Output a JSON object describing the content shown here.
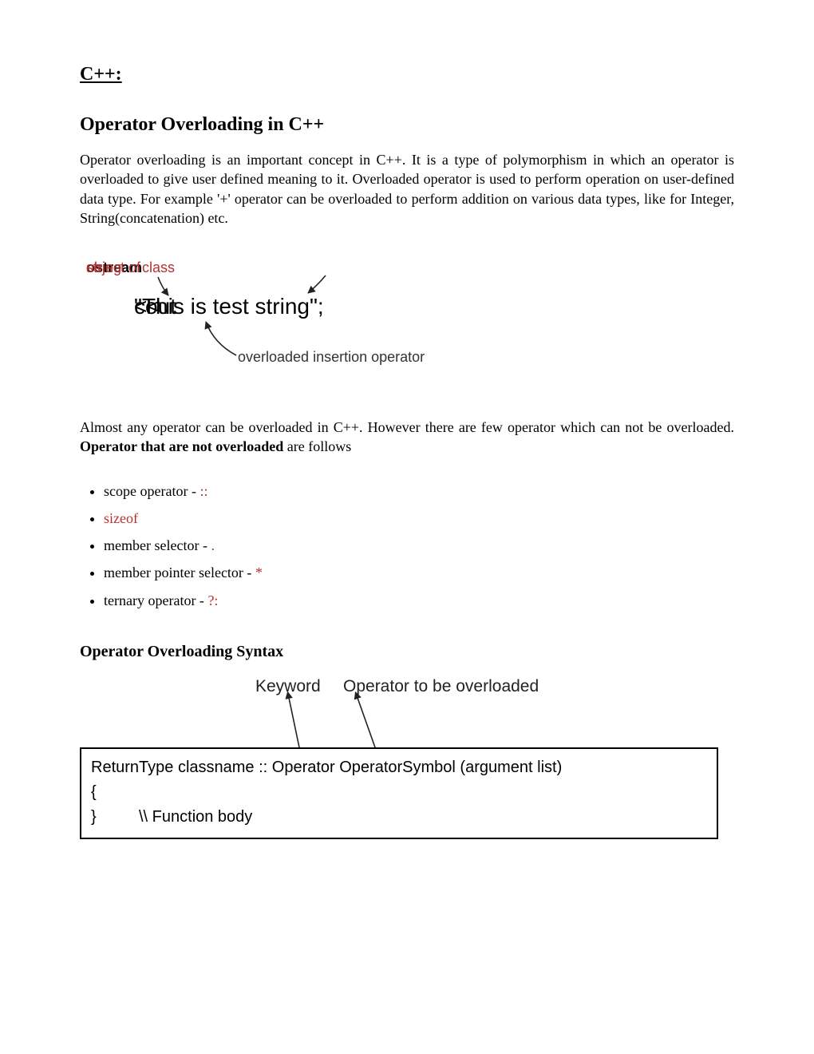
{
  "title": "C++:",
  "heading": "Operator Overloading in C++",
  "intro": "Operator overloading is an important concept in C++. It is a type of polymorphism in which an operator is overloaded to give user defined meaning to it. Overloaded operator is used to perform operation on user-defined data type. For example '+' operator can be overloaded to perform addition on various data types, like for Integer, String(concatenation) etc.",
  "fig1": {
    "label_ostream_pre": "object of ",
    "label_ostream_bold": "ostream",
    "label_ostream_post": " class",
    "label_string": "string",
    "code_cout": "cout ",
    "code_op": "<<",
    "code_string": " \"This is test string\";",
    "label_insertion": "overloaded insertion operator"
  },
  "para2_pre": "Almost any operator can be overloaded in C++. However there are few operator which can not be overloaded. ",
  "para2_bold": "Operator that are not overloaded",
  "para2_post": " are follows",
  "list": [
    {
      "text": "scope operator - ",
      "code": "::"
    },
    {
      "text": "",
      "code": "sizeof"
    },
    {
      "text": "member selector - ",
      "code": "."
    },
    {
      "text": "member pointer selector - ",
      "code": "*"
    },
    {
      "text": "ternary operator - ",
      "code": "?:"
    }
  ],
  "sub_heading": "Operator Overloading Syntax",
  "fig2": {
    "label_keyword": "Keyword",
    "label_operator": "Operator to be overloaded",
    "line1": "ReturnType classname :: Operator OperatorSymbol (argument list)",
    "line2": "{",
    "line3": "\\\\ Function body",
    "line4": "}"
  }
}
